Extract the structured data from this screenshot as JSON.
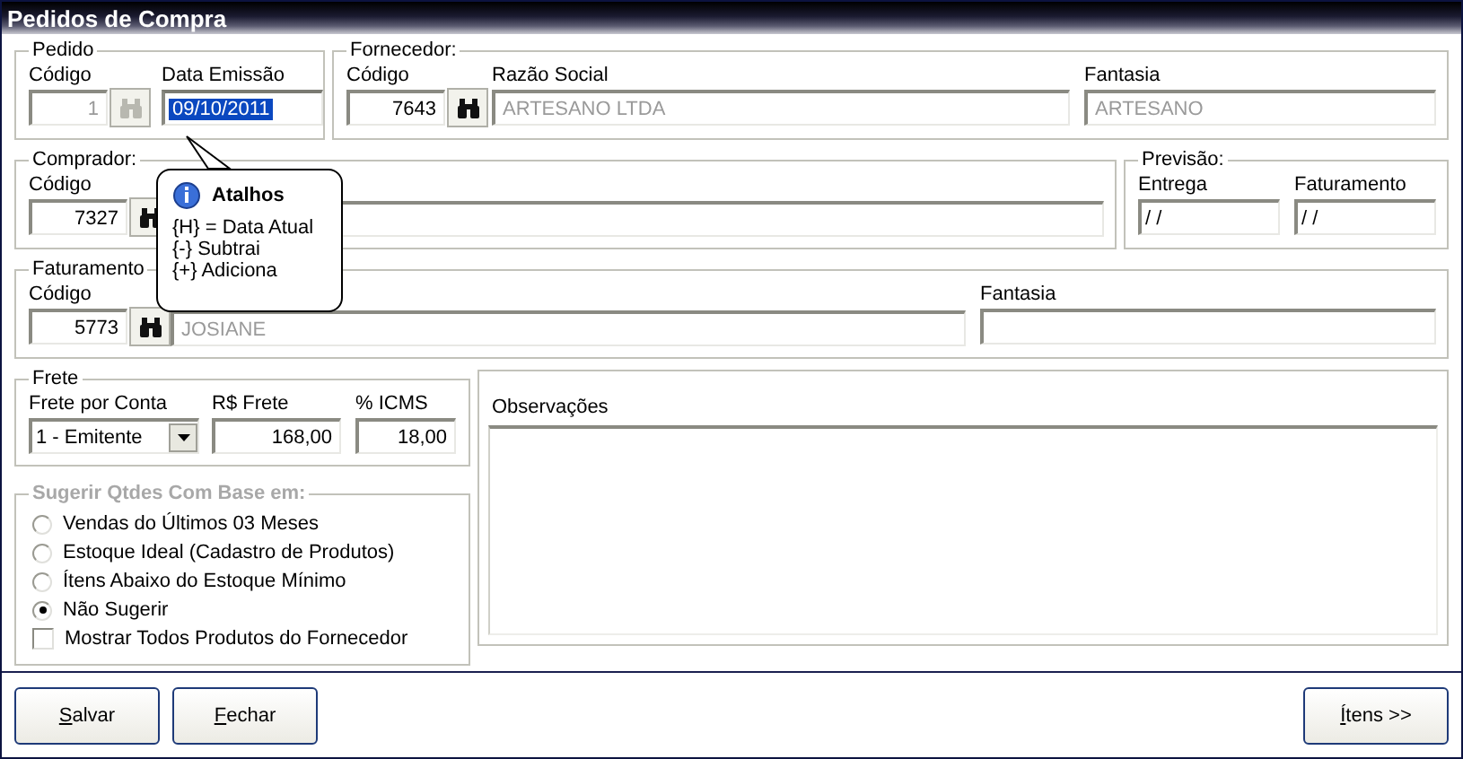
{
  "window": {
    "title": "Pedidos de Compra"
  },
  "pedido": {
    "legend": "Pedido",
    "fields": [
      {
        "kind": "lookup",
        "label": "Código",
        "value": "1",
        "disabled": true
      },
      {
        "kind": "date",
        "label": "Data Emissão",
        "value": "09/10/2011",
        "focused": true
      }
    ]
  },
  "fornecedor": {
    "legend": "Fornecedor:",
    "fields": [
      {
        "kind": "lookup",
        "label": "Código",
        "value": "7643",
        "disabled": false
      },
      {
        "kind": "text",
        "label": "Razão Social",
        "value": "ARTESANO LTDA",
        "readonly": true
      },
      {
        "kind": "text",
        "label": "Fantasia",
        "value": "ARTESANO",
        "readonly": true
      }
    ]
  },
  "comprador": {
    "legend": "Comprador:",
    "fields": [
      {
        "kind": "lookup",
        "label": "Código",
        "value": "7327",
        "disabled": false
      },
      {
        "kind": "text"
      }
    ]
  },
  "previsao": {
    "legend": "Previsão:",
    "fields": [
      {
        "kind": "date",
        "label": "Entrega",
        "value": "/ /",
        "focused": false
      },
      {
        "kind": "date",
        "label": "Faturamento",
        "value": "/ /",
        "focused": false
      }
    ]
  },
  "faturamento": {
    "legend": "Faturamento",
    "fields": [
      {
        "kind": "lookup",
        "label": "Código",
        "value": "5773",
        "disabled": false
      },
      {
        "kind": "text",
        "value": "JOSIANE",
        "readonly": true
      },
      {
        "kind": "text",
        "label": "Fantasia"
      }
    ]
  },
  "frete": {
    "legend": "Frete",
    "fields": [
      {
        "kind": "select",
        "label": "Frete por Conta",
        "value": "1 - Emitente"
      },
      {
        "kind": "number",
        "label": "R$  Frete",
        "value": "168,00"
      },
      {
        "kind": "number",
        "label": "% ICMS",
        "value": "18,00"
      }
    ]
  },
  "sugerir": {
    "legend": "Sugerir Qtdes Com Base em:",
    "options": [
      {
        "label": "Vendas do Últimos 03 Meses",
        "selected": false
      },
      {
        "label": "Estoque Ideal (Cadastro de Produtos)",
        "selected": false
      },
      {
        "label": "Ítens Abaixo do Estoque Mínimo",
        "selected": false
      },
      {
        "label": "Não Sugerir",
        "selected": true
      }
    ],
    "checkbox": {
      "label": "Mostrar Todos Produtos do Fornecedor",
      "checked": false
    }
  },
  "observacoes": {
    "label": "Observações"
  },
  "tooltip": {
    "title": "Atalhos",
    "lines": [
      "{H} = Data Atual",
      "{-} Subtrai",
      "{+} Adiciona"
    ]
  },
  "buttons": [
    {
      "label": "Salvar"
    },
    {
      "label": "Fechar"
    },
    {
      "label": "Ítens >>"
    }
  ]
}
